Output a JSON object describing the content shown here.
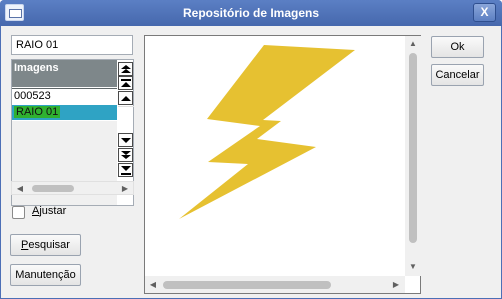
{
  "window": {
    "title": "Repositório de Imagens",
    "close_glyph": "X"
  },
  "form": {
    "name_value": "RAIO 01",
    "list_header": "Imagens",
    "list_items": [
      "000523",
      "RAIO 01"
    ],
    "selected_item": "RAIO 01",
    "adjust_label_accel": "A",
    "adjust_label_rest": "justar",
    "adjust_checked": false
  },
  "buttons": {
    "search_accel": "P",
    "search_rest": "esquisar",
    "maintenance": "Manutenção",
    "ok": "Ok",
    "cancel": "Cancelar"
  },
  "image": {
    "subject": "lightning-bolt",
    "fill_color": "#e6c131"
  },
  "colors": {
    "titlebar": "#4c6fb6",
    "list_header_bg": "#7e878a",
    "row_selected_bg": "#2fa3c4",
    "row_selected_text_bg": "#2fb130"
  }
}
